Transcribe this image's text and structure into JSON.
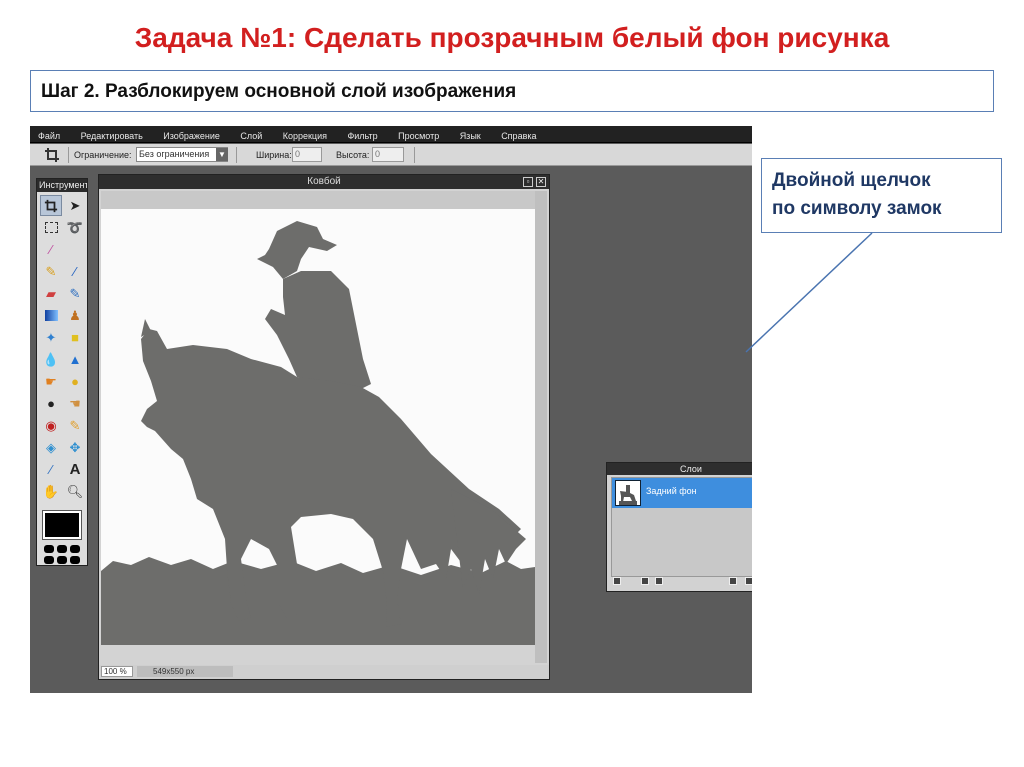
{
  "slide": {
    "title": "Задача №1: Сделать прозрачным белый фон рисунка",
    "step": "Шаг 2. Разблокируем основной слой изображения",
    "callout": {
      "line1": "Двойной щелчок",
      "line2": "по символу замок"
    }
  },
  "menubar": {
    "items": [
      "Файл",
      "Редактировать",
      "Изображение",
      "Слой",
      "Коррекция",
      "Фильтр",
      "Просмотр",
      "Язык",
      "Справка"
    ]
  },
  "options": {
    "constraint_label": "Ограничение:",
    "constraint_value": "Без ограничения",
    "width_label": "Ширина:",
    "width_value": "0",
    "height_label": "Высота:",
    "height_value": "0"
  },
  "tools_panel": {
    "title": "Инструменты"
  },
  "document": {
    "title": "Ковбой",
    "zoom": "100 %",
    "size": "549x550 px"
  },
  "layers_panel": {
    "title": "Слои",
    "layer_name": "Задний фон"
  },
  "colors": {
    "title_red": "#d21f1f",
    "callout_blue": "#1f3864",
    "layer_selected": "#3e8ede",
    "silhouette": "#6d6d6b"
  }
}
